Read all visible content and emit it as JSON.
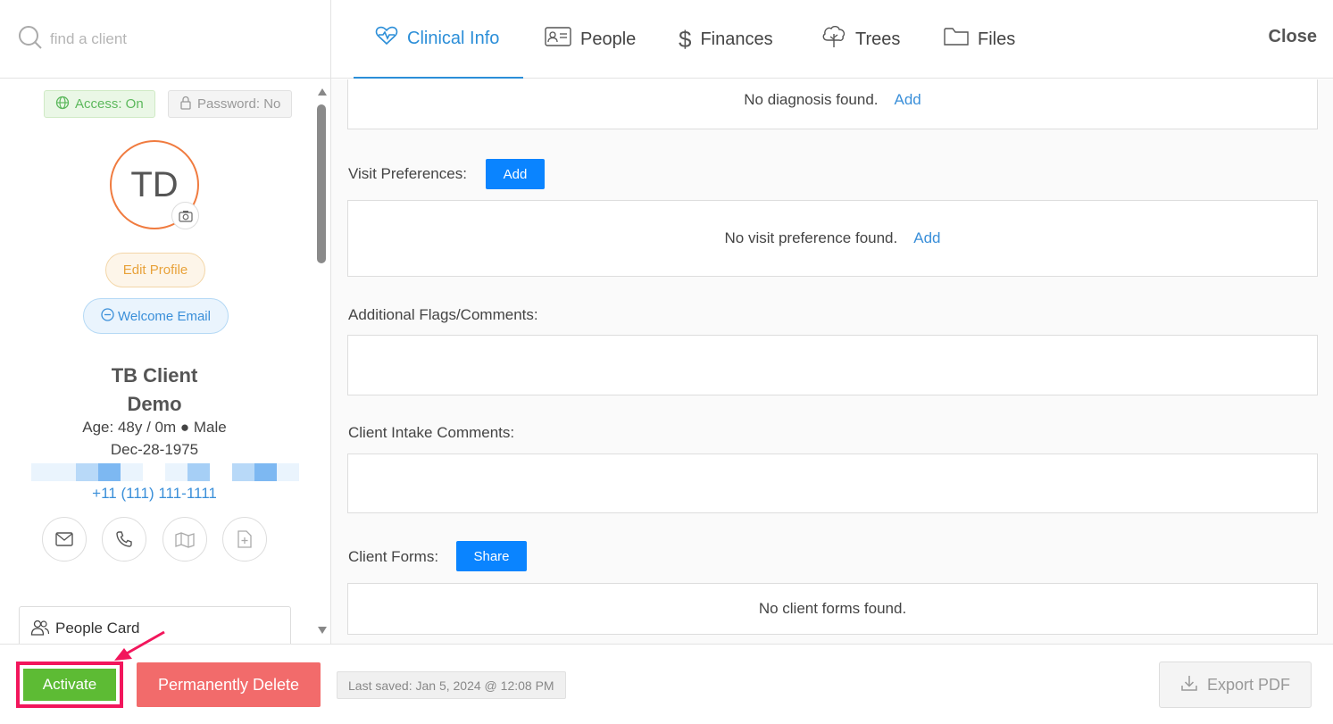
{
  "search": {
    "placeholder": "find a client"
  },
  "profile": {
    "access": "Access: On",
    "password": "Password: No",
    "initials": "TD",
    "edit_profile": "Edit Profile",
    "welcome_email": "Welcome Email",
    "name_line1": "TB Client",
    "name_line2": "Demo",
    "age": "Age: 48y / 0m ● Male",
    "dob": "Dec-28-1975",
    "phone": "+11 (111) 111-1111",
    "people_card": "People Card"
  },
  "tabs": [
    {
      "label": "Clinical Info",
      "icon": "heartbeat-icon",
      "active": true
    },
    {
      "label": "People",
      "icon": "id-card-icon",
      "active": false
    },
    {
      "label": "Finances",
      "icon": "dollar-icon",
      "active": false
    },
    {
      "label": "Trees",
      "icon": "tree-icon",
      "active": false
    },
    {
      "label": "Files",
      "icon": "folder-icon",
      "active": false
    }
  ],
  "close_label": "Close",
  "main": {
    "diagnosis_empty": "No diagnosis found.",
    "diagnosis_add": "Add",
    "visit_prefs_label": "Visit Preferences:",
    "visit_prefs_add_btn": "Add",
    "visit_prefs_empty": "No visit preference found.",
    "visit_prefs_add_link": "Add",
    "flags_label": "Additional Flags/Comments:",
    "intake_label": "Client Intake Comments:",
    "forms_label": "Client Forms:",
    "forms_share_btn": "Share",
    "forms_empty": "No client forms found."
  },
  "bottom": {
    "activate": "Activate",
    "permanently_delete": "Permanently Delete",
    "last_saved": "Last saved: Jan 5, 2024 @ 12:08 PM",
    "export_pdf": "Export PDF"
  },
  "colors": {
    "accent": "#2b8ed8",
    "activate_green": "#5dbb34",
    "delete_red": "#f26b6b",
    "highlight_pink": "#f2165c",
    "avatar_ring": "#f07b3f"
  }
}
